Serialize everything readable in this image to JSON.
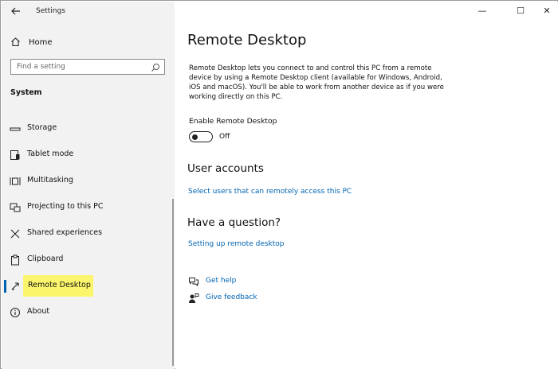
{
  "window": {
    "title": "Settings",
    "minimize_glyph": "—",
    "maximize_glyph": "☐",
    "close_glyph": "✕"
  },
  "sidebar": {
    "home_label": "Home",
    "search_placeholder": "Find a setting",
    "section_title": "System",
    "items": [
      {
        "label": "Storage",
        "icon": "storage-icon"
      },
      {
        "label": "Tablet mode",
        "icon": "tablet-mode-icon"
      },
      {
        "label": "Multitasking",
        "icon": "multitasking-icon"
      },
      {
        "label": "Projecting to this PC",
        "icon": "projecting-icon"
      },
      {
        "label": "Shared experiences",
        "icon": "shared-experiences-icon"
      },
      {
        "label": "Clipboard",
        "icon": "clipboard-icon"
      },
      {
        "label": "Remote Desktop",
        "icon": "remote-desktop-icon",
        "selected": true
      },
      {
        "label": "About",
        "icon": "about-icon"
      }
    ]
  },
  "main": {
    "title": "Remote Desktop",
    "description": "Remote Desktop lets you connect to and control this PC from a remote device by using a Remote Desktop client (available for Windows, Android, iOS and macOS). You'll be able to work from another device as if you were working directly on this PC.",
    "toggle_label": "Enable Remote Desktop",
    "toggle_state": "Off",
    "user_accounts_heading": "User accounts",
    "select_users_link": "Select users that can remotely access this PC",
    "question_heading": "Have a question?",
    "setup_link": "Setting up remote desktop",
    "get_help": "Get help",
    "give_feedback": "Give feedback"
  },
  "colors": {
    "accent": "#0063b1",
    "highlight": "#fbf56c",
    "sidebar_bg": "#f2f2f2"
  }
}
